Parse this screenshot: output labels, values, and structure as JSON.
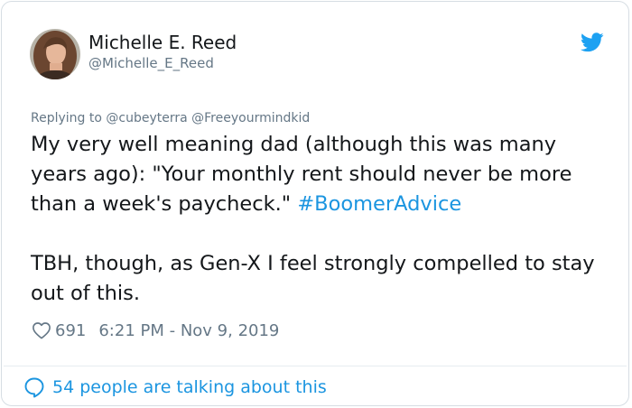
{
  "author": {
    "name": "Michelle E. Reed",
    "handle": "@Michelle_E_Reed"
  },
  "reply": {
    "prefix": "Replying to",
    "mentions": "@cubeyterra @Freeyourmindkid"
  },
  "tweet": {
    "line1_text": "My very well meaning dad (although this was many years ago): \"Your monthly rent should never be more than a week's paycheck.\" ",
    "hashtag": "#BoomerAdvice",
    "paragraph2": "TBH, though, as Gen-X I feel strongly compelled to stay out of this."
  },
  "meta": {
    "likes": "691",
    "timestamp": "6:21 PM - Nov 9, 2019"
  },
  "footer": {
    "talking": "54 people are talking about this"
  },
  "icons": {
    "logo": "twitter-bird-icon",
    "like": "heart-outline-icon",
    "talk": "speech-bubble-icon"
  },
  "colors": {
    "brand": "#1da1f2",
    "link": "#1b95e0",
    "muted": "#657786",
    "text": "#14171a"
  }
}
